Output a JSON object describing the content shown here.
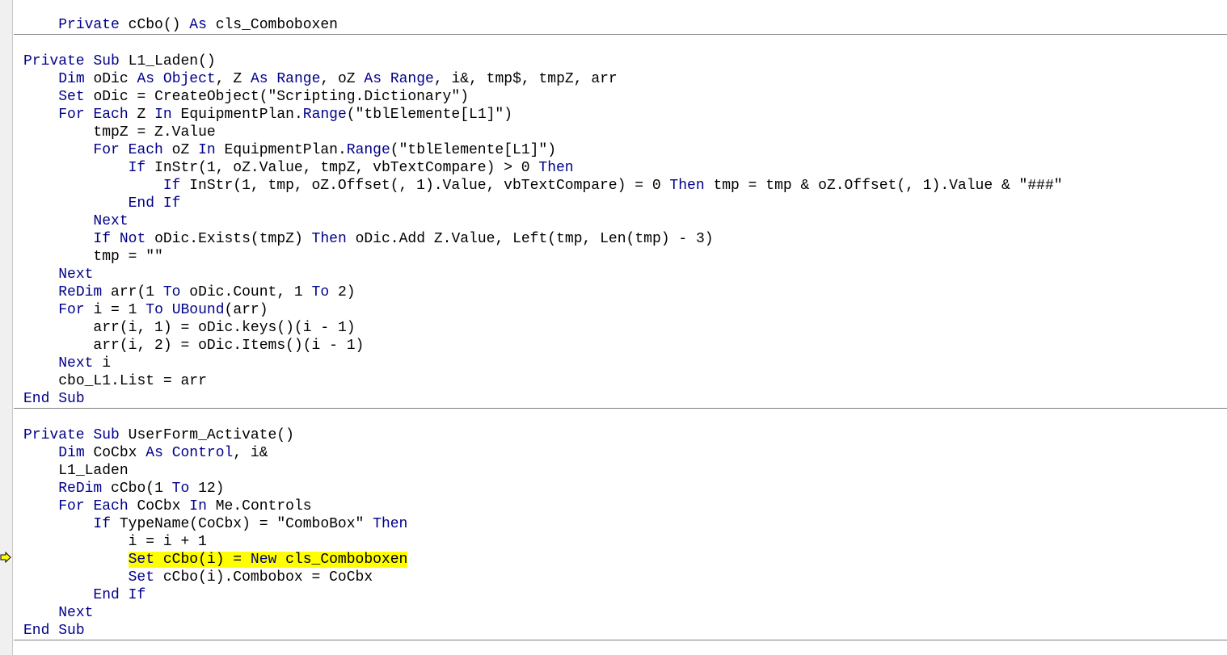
{
  "editor": {
    "margin": {
      "execution_indicator_icon": "execution-pointer-arrow-icon",
      "execution_indicator_color": "#ffff00",
      "execution_line_index": 31
    },
    "colors": {
      "keyword": "#00008b",
      "text": "#000000",
      "highlight": "#ffff00",
      "separator": "#808080",
      "margin": "#f0f0f0"
    },
    "lines": [
      {
        "text": "    Private cCbo() As cls_Comboboxen",
        "separator_after": true
      },
      {
        "text": "",
        "separator_after": false
      },
      {
        "text": "Private Sub L1_Laden()",
        "separator_after": false
      },
      {
        "text": "    Dim oDic As Object, Z As Range, oZ As Range, i&, tmp$, tmpZ, arr",
        "separator_after": false
      },
      {
        "text": "    Set oDic = CreateObject(\"Scripting.Dictionary\")",
        "separator_after": false
      },
      {
        "text": "    For Each Z In EquipmentPlan.Range(\"tblElemente[L1]\")",
        "separator_after": false
      },
      {
        "text": "        tmpZ = Z.Value",
        "separator_after": false
      },
      {
        "text": "        For Each oZ In EquipmentPlan.Range(\"tblElemente[L1]\")",
        "separator_after": false
      },
      {
        "text": "            If InStr(1, oZ.Value, tmpZ, vbTextCompare) > 0 Then",
        "separator_after": false
      },
      {
        "text": "                If InStr(1, tmp, oZ.Offset(, 1).Value, vbTextCompare) = 0 Then tmp = tmp & oZ.Offset(, 1).Value & \"###\"",
        "separator_after": false
      },
      {
        "text": "            End If",
        "separator_after": false
      },
      {
        "text": "        Next",
        "separator_after": false
      },
      {
        "text": "        If Not oDic.Exists(tmpZ) Then oDic.Add Z.Value, Left(tmp, Len(tmp) - 3)",
        "separator_after": false
      },
      {
        "text": "        tmp = \"\"",
        "separator_after": false
      },
      {
        "text": "    Next",
        "separator_after": false
      },
      {
        "text": "    ReDim arr(1 To oDic.Count, 1 To 2)",
        "separator_after": false
      },
      {
        "text": "    For i = 1 To UBound(arr)",
        "separator_after": false
      },
      {
        "text": "        arr(i, 1) = oDic.keys()(i - 1)",
        "separator_after": false
      },
      {
        "text": "        arr(i, 2) = oDic.Items()(i - 1)",
        "separator_after": false
      },
      {
        "text": "    Next i",
        "separator_after": false
      },
      {
        "text": "    cbo_L1.List = arr",
        "separator_after": false
      },
      {
        "text": "End Sub",
        "separator_after": true
      },
      {
        "text": "",
        "separator_after": false
      },
      {
        "text": "Private Sub UserForm_Activate()",
        "separator_after": false
      },
      {
        "text": "    Dim CoCbx As Control, i&",
        "separator_after": false
      },
      {
        "text": "    L1_Laden",
        "separator_after": false
      },
      {
        "text": "    ReDim cCbo(1 To 12)",
        "separator_after": false
      },
      {
        "text": "    For Each CoCbx In Me.Controls",
        "separator_after": false
      },
      {
        "text": "        If TypeName(CoCbx) = \"ComboBox\" Then",
        "separator_after": false
      },
      {
        "text": "            i = i + 1",
        "separator_after": false
      },
      {
        "text": "            Set cCbo(i) = New cls_Comboboxen",
        "separator_after": false,
        "highlighted": true
      },
      {
        "text": "            Set cCbo(i).Combobox = CoCbx",
        "separator_after": false
      },
      {
        "text": "        End If",
        "separator_after": false
      },
      {
        "text": "    Next",
        "separator_after": false
      },
      {
        "text": "End Sub",
        "separator_after": true
      }
    ],
    "keywords": [
      "Private",
      "Sub",
      "As",
      "Dim",
      "Object",
      "Set",
      "For",
      "Each",
      "In",
      "If",
      "Then",
      "End",
      "Next",
      "Not",
      "ReDim",
      "To",
      "Range",
      "Control",
      "UBound",
      "New"
    ]
  }
}
